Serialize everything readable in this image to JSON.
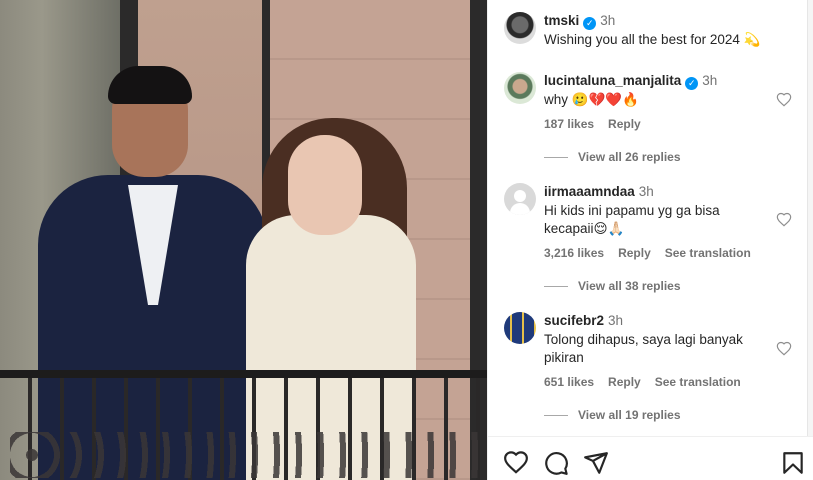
{
  "post": {
    "author": "tmski",
    "time": "3h",
    "caption": "Wishing you all the best for 2024 💫"
  },
  "comments": [
    {
      "user": "lucintaluna_manjalita",
      "verified": true,
      "time": "3h",
      "text": "why 🥲💔❤️🔥",
      "likes": "187 likes",
      "reply": "Reply",
      "translation": "",
      "replies": "View all 26 replies"
    },
    {
      "user": "iirmaaamndaa",
      "verified": false,
      "time": "3h",
      "text": "Hi kids ini papamu yg ga bisa kecapaii😌🙏🏻",
      "likes": "3,216 likes",
      "reply": "Reply",
      "translation": "See translation",
      "replies": "View all 38 replies"
    },
    {
      "user": "sucifebr2",
      "verified": false,
      "time": "3h",
      "text": "Tolong dihapus, saya lagi banyak pikiran",
      "likes": "651 likes",
      "reply": "Reply",
      "translation": "See translation",
      "replies": "View all 19 replies"
    }
  ],
  "actions": {
    "like": "heart-icon",
    "comment": "comment-icon",
    "share": "send-icon",
    "save": "bookmark-icon"
  },
  "colors": {
    "verified": "#0095f6",
    "text": "#262626",
    "secondary": "#737373"
  }
}
